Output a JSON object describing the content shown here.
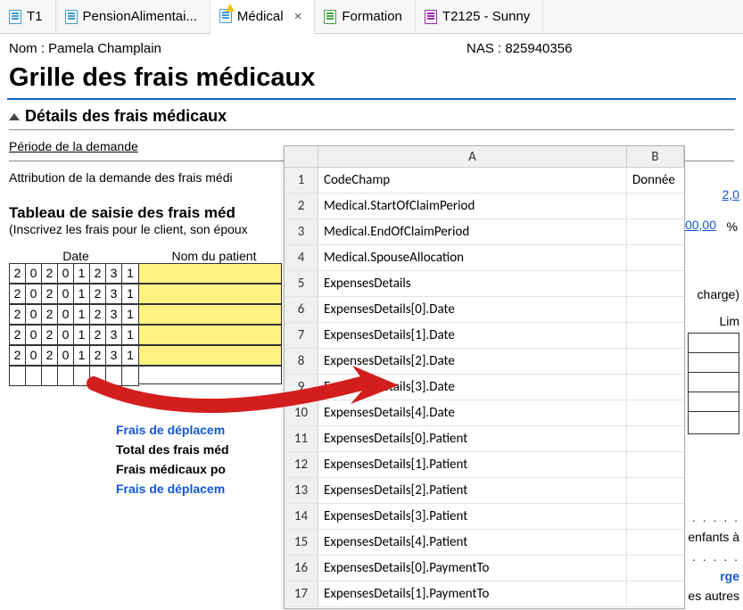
{
  "tabs": [
    {
      "label": "T1"
    },
    {
      "label": "PensionAlimentai..."
    },
    {
      "label": "Médical",
      "active": true
    },
    {
      "label": "Formation"
    },
    {
      "label": "T2125 - Sunny"
    }
  ],
  "header": {
    "name_label": "Nom : Pamela Champlain",
    "nas_label": "NAS : 825940356"
  },
  "page_title": "Grille des frais médicaux",
  "section_title": "Détails des frais médicaux",
  "periode_label": "Période de la demande",
  "attribution_label": "Attribution de la demande des frais médi",
  "table_title": "Tableau de saisie des frais méd",
  "table_sub": "(Inscrivez les frais pour le client, son époux",
  "col_date": "Date",
  "col_patient": "Nom du patient",
  "date_rows": [
    [
      "2",
      "0",
      "2",
      "0",
      "1",
      "2",
      "3",
      "1"
    ],
    [
      "2",
      "0",
      "2",
      "0",
      "1",
      "2",
      "3",
      "1"
    ],
    [
      "2",
      "0",
      "2",
      "0",
      "1",
      "2",
      "3",
      "1"
    ],
    [
      "2",
      "0",
      "2",
      "0",
      "1",
      "2",
      "3",
      "1"
    ],
    [
      "2",
      "0",
      "2",
      "0",
      "1",
      "2",
      "3",
      "1"
    ]
  ],
  "bottom": {
    "l1": "Frais de déplacem",
    "l2": "Total des frais méd",
    "l3": "Frais médicaux po",
    "l4": "Frais de déplacem"
  },
  "sheet": {
    "colA": "A",
    "colB": "B",
    "h1": "CodeChamp",
    "h1b": "Donnée",
    "rows": [
      "Medical.StartOfClaimPeriod",
      "Medical.EndOfClaimPeriod",
      "Medical.SpouseAllocation",
      "ExpensesDetails",
      "ExpensesDetails[0].Date",
      "ExpensesDetails[1].Date",
      "ExpensesDetails[2].Date",
      "ExpensesDetails[3].Date",
      "ExpensesDetails[4].Date",
      "ExpensesDetails[0].Patient",
      "ExpensesDetails[1].Patient",
      "ExpensesDetails[2].Patient",
      "ExpensesDetails[3].Patient",
      "ExpensesDetails[4].Patient",
      "ExpensesDetails[0].PaymentTo",
      "ExpensesDetails[1].PaymentTo"
    ]
  },
  "right": {
    "v1": "2,0",
    "v2": "00,00",
    "pct": "%",
    "charge": "charge)",
    "lim": "Lim",
    "enfants": "enfants à",
    "rge": "rge",
    "autres": "es autres"
  }
}
